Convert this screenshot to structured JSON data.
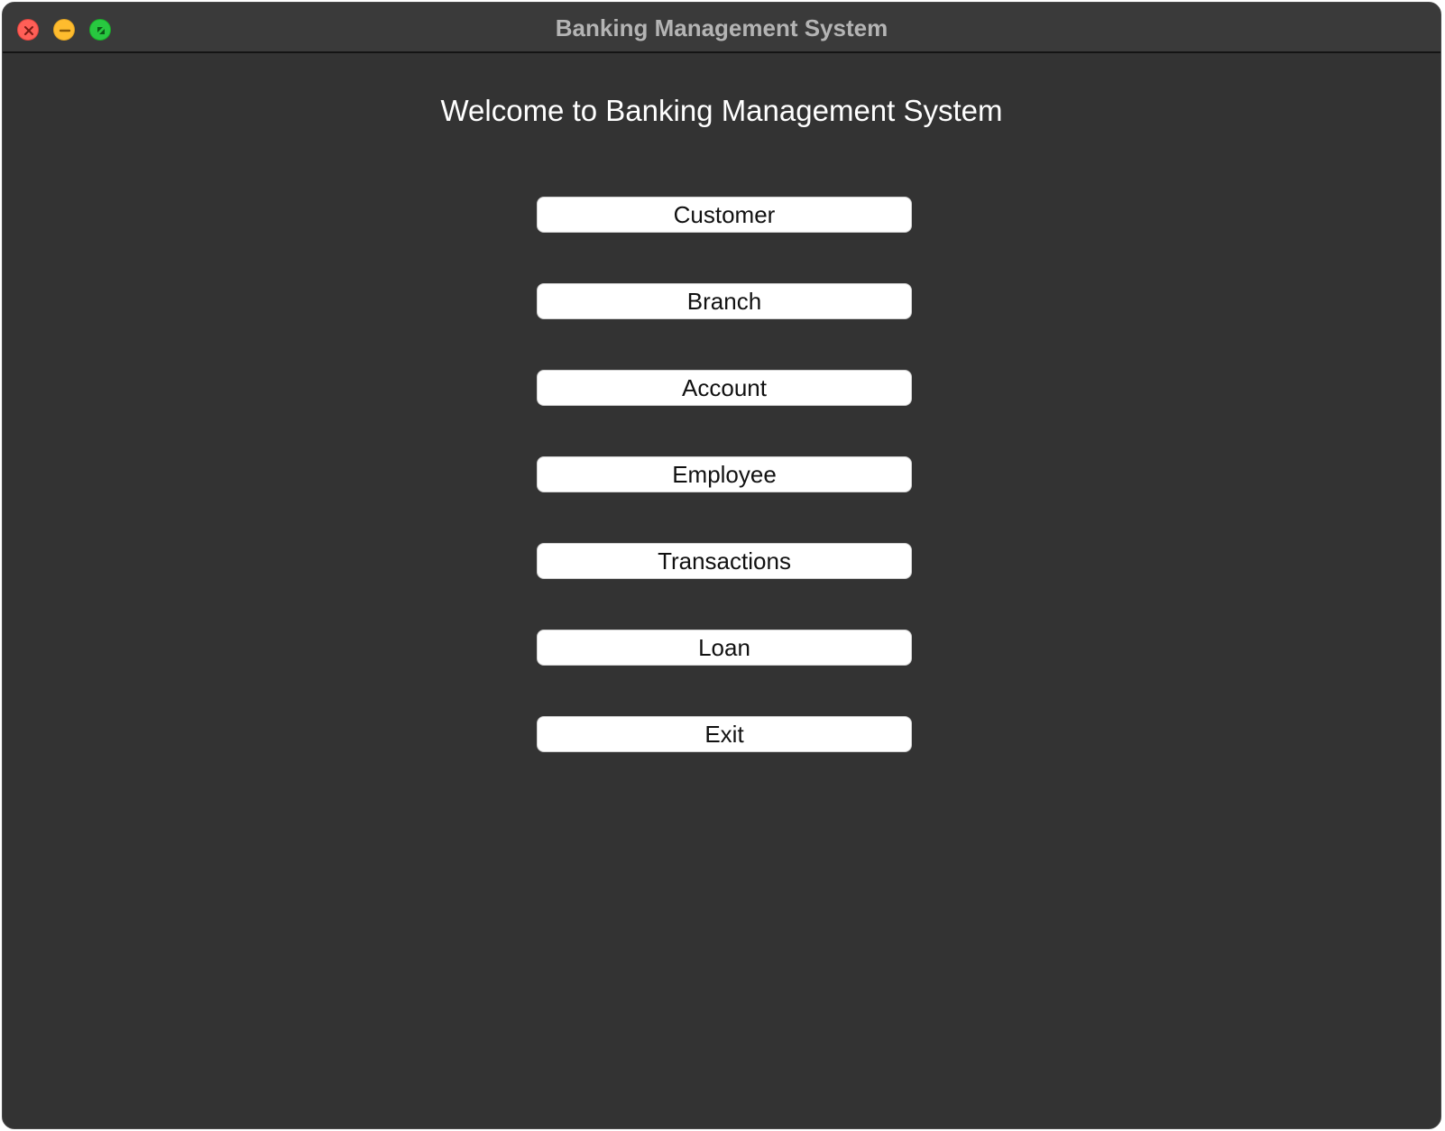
{
  "window": {
    "title": "Banking Management System",
    "controls": {
      "close_icon": "close-icon",
      "minimize_icon": "minimize-icon",
      "maximize_icon": "fullscreen-icon"
    }
  },
  "main": {
    "heading": "Welcome to Banking Management System",
    "buttons": [
      {
        "label": "Customer"
      },
      {
        "label": "Branch"
      },
      {
        "label": "Account"
      },
      {
        "label": "Employee"
      },
      {
        "label": "Transactions"
      },
      {
        "label": "Loan"
      },
      {
        "label": "Exit"
      }
    ]
  },
  "colors": {
    "background": "#333333",
    "titlebar": "#3a3a3a",
    "button_bg": "#ffffff",
    "close": "#ff5f57",
    "minimize": "#febc2e",
    "maximize": "#28c840"
  }
}
